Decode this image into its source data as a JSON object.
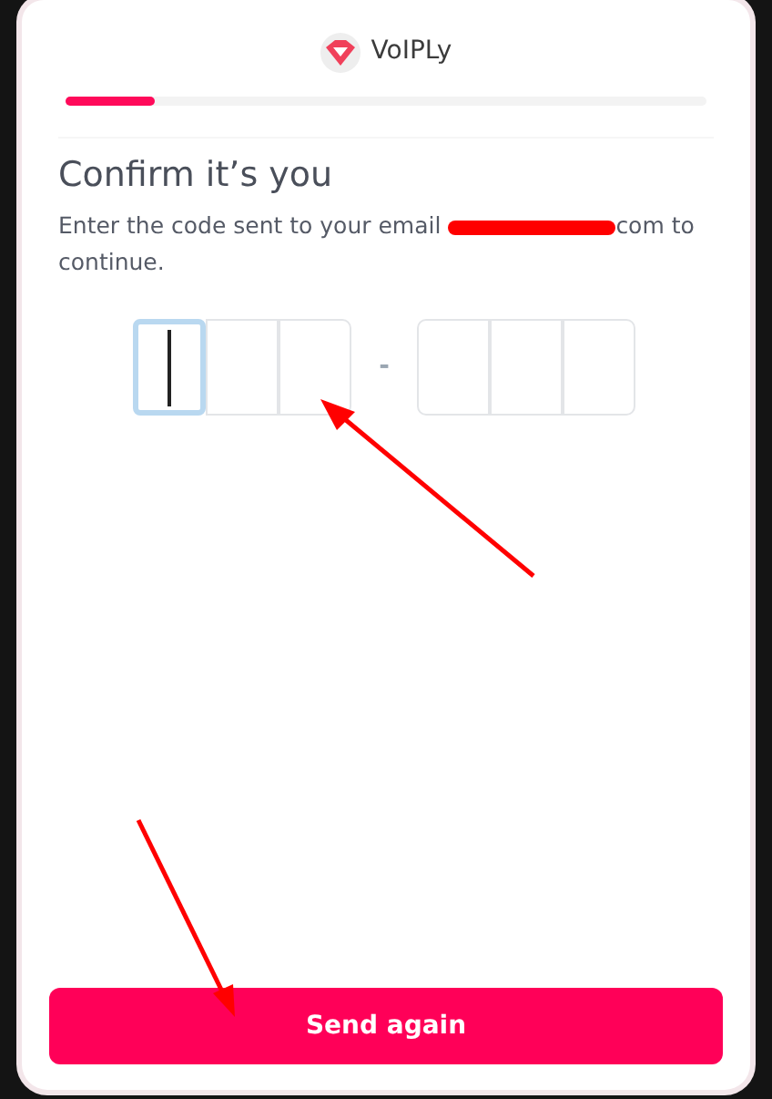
{
  "brand": {
    "name": "VoIPLy"
  },
  "progress": {
    "level": 0.14
  },
  "title": "Confirm it’s you",
  "message": {
    "before": "Enter the code sent to your email ",
    "after": "com to continue."
  },
  "code": {
    "groups": [
      {
        "cells": [
          {
            "focused": true
          },
          {
            "focused": false
          },
          {
            "focused": false
          }
        ]
      },
      {
        "cells": [
          {
            "focused": false
          },
          {
            "focused": false
          },
          {
            "focused": false
          }
        ]
      }
    ],
    "separator": "-"
  },
  "button": {
    "label": "Send again"
  }
}
